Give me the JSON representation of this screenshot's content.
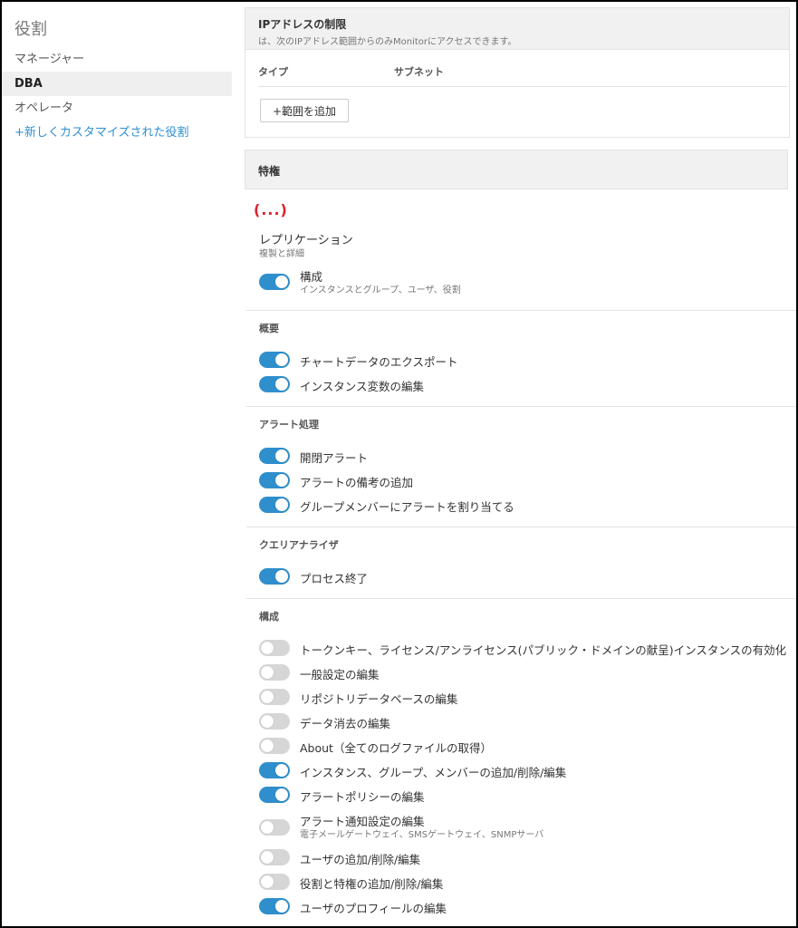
{
  "sidebar": {
    "title": "役割",
    "roles": [
      {
        "label": "マネージャー",
        "active": false
      },
      {
        "label": "DBA",
        "active": true
      },
      {
        "label": "オペレータ",
        "active": false
      }
    ],
    "add_role": "+新しくカスタマイズされた役割"
  },
  "ip_restriction": {
    "title": "IPアドレスの制限",
    "subtitle": "は、次のIPアドレス範囲からのみMonitorにアクセスできます。",
    "col_type": "タイプ",
    "col_subnet": "サブネット",
    "add_range_label": "+範囲を追加"
  },
  "privileges": {
    "title": "特権",
    "ellipsis": "(...)",
    "replication": {
      "title": "レプリケーション",
      "subtitle": "複製と詳細",
      "config_label": "構成",
      "config_sub": "インスタンスとグループ、ユーザ、役割"
    },
    "overview_label": "概要",
    "overview": [
      {
        "label": "チャートデータのエクスポート",
        "on": true
      },
      {
        "label": "インスタンス変数の編集",
        "on": true
      }
    ],
    "alerts_label": "アラート処理",
    "alerts": [
      {
        "label": "開閉アラート",
        "on": true
      },
      {
        "label": "アラートの備考の追加",
        "on": true
      },
      {
        "label": "グループメンバーにアラートを割り当てる",
        "on": true
      }
    ],
    "query_label": "クエリアナライザ",
    "query": [
      {
        "label": "プロセス終了",
        "on": true
      }
    ],
    "config_section_label": "構成",
    "config": [
      {
        "label": "トークンキー、ライセンス/アンライセンス(パブリック・ドメインの献呈)インスタンスの有効化",
        "on": false
      },
      {
        "label": "一般設定の編集",
        "on": false
      },
      {
        "label": "リポジトリデータベースの編集",
        "on": false
      },
      {
        "label": "データ消去の編集",
        "on": false
      },
      {
        "label": "About（全てのログファイルの取得）",
        "on": false
      },
      {
        "label": "インスタンス、グループ、メンバーの追加/削除/編集",
        "on": true
      },
      {
        "label": "アラートポリシーの編集",
        "on": true
      },
      {
        "label": "アラート通知設定の編集",
        "sub": "電子メールゲートウェイ、SMSゲートウェイ、SNMPサーバ",
        "on": false
      },
      {
        "label": "ユーザの追加/削除/編集",
        "on": false
      },
      {
        "label": "役割と特権の追加/削除/編集",
        "on": false
      },
      {
        "label": "ユーザのプロフィールの編集",
        "on": true
      }
    ]
  }
}
